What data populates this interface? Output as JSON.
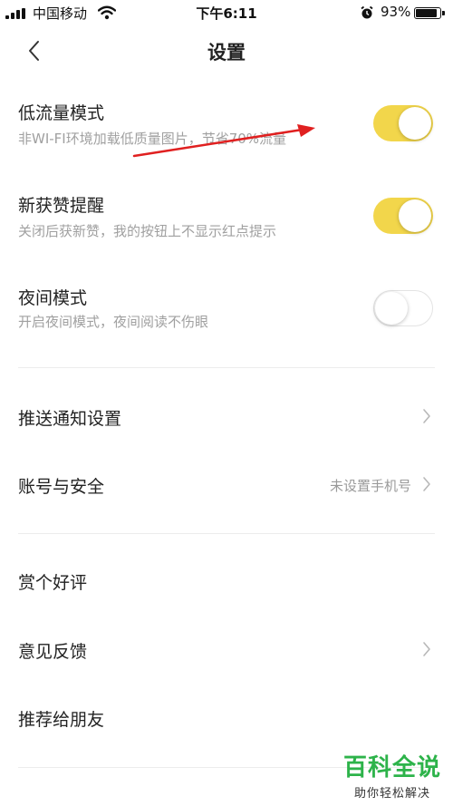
{
  "status_bar": {
    "carrier": "中国移动",
    "time": "下午6:11",
    "battery_percent": "93%",
    "battery_level": 0.93,
    "icons": [
      "signal-icon",
      "wifi-icon",
      "alarm-icon",
      "battery-icon"
    ]
  },
  "nav": {
    "title": "设置",
    "back_icon": "chevron-left-icon"
  },
  "toggle_settings": [
    {
      "title": "低流量模式",
      "subtitle": "非WI-FI环境加载低质量图片，节省70%流量",
      "on": true
    },
    {
      "title": "新获赞提醒",
      "subtitle": "关闭后获新赞，我的按钮上不显示红点提示",
      "on": true
    },
    {
      "title": "夜间模式",
      "subtitle": "开启夜间模式，夜间阅读不伤眼",
      "on": false
    }
  ],
  "menu_group_1": [
    {
      "title": "推送通知设置",
      "value": ""
    },
    {
      "title": "账号与安全",
      "value": "未设置手机号"
    }
  ],
  "menu_group_2": [
    {
      "title": "赏个好评"
    },
    {
      "title": "意见反馈"
    },
    {
      "title": "推荐给朋友"
    }
  ],
  "colors": {
    "toggle_on": "#f2d64b",
    "annotation_arrow": "#e02020",
    "watermark": "#2db34a"
  },
  "watermark": {
    "title": "百科全说",
    "subtitle": "助你轻松解决"
  }
}
